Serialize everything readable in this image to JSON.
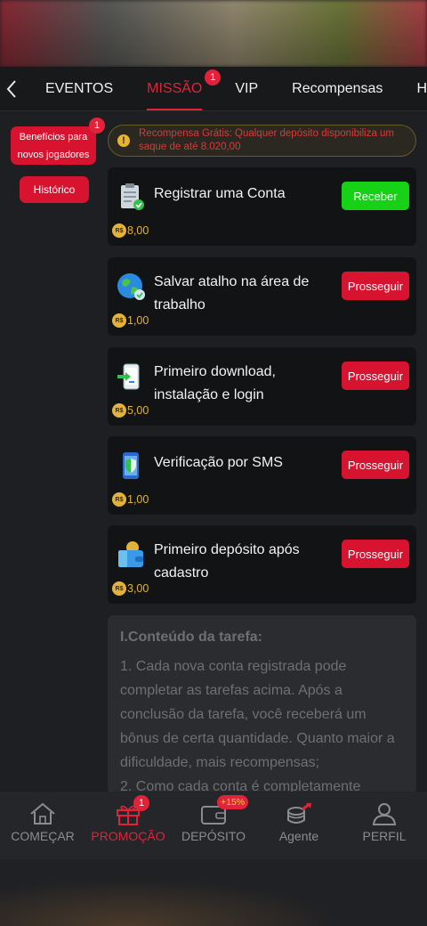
{
  "tabs": {
    "items": [
      "EVENTOS",
      "MISSÃO",
      "VIP",
      "Recompensas",
      "H"
    ],
    "active": "MISSÃO",
    "mission_badge": "1"
  },
  "left": {
    "new_players_label": "Benefícios para novos jogadores",
    "new_players_badge": "1",
    "history_label": "Histórico"
  },
  "notice": {
    "text": "Recompensa Grátis: Qualquer depósito disponibiliza um saque de até 8.020,00"
  },
  "currency_symbol": "R$",
  "tasks": [
    {
      "title": "Registrar uma Conta",
      "reward": "8,00",
      "action": "Receber",
      "icon": "clipboard-check-icon"
    },
    {
      "title": "Salvar atalho na área de trabalho",
      "reward": "1,00",
      "action": "Prosseguir",
      "icon": "globe-icon"
    },
    {
      "title": "Primeiro download, instalação e login",
      "reward": "5,00",
      "action": "Prosseguir",
      "icon": "phone-download-icon"
    },
    {
      "title": "Verificação por SMS",
      "reward": "1,00",
      "action": "Prosseguir",
      "icon": "phone-shield-icon"
    },
    {
      "title": "Primeiro depósito após cadastro",
      "reward": "3,00",
      "action": "Prosseguir",
      "icon": "wallet-coin-icon"
    }
  ],
  "content": {
    "heading": "I.Conteúdo da tarefa:",
    "p1": "1. Cada nova conta registrada pode completar as tarefas acima. Após a conclusão da tarefa, você receberá um bônus de certa quantidade. Quanto maior a dificuldade, mais recompensas;",
    "p2": "2. Como cada conta é completamente"
  },
  "nav": {
    "items": [
      "COMEÇAR",
      "PROMOÇÃO",
      "DEPÓSITO",
      "Agente",
      "PERFIL"
    ],
    "promo_badge": "1",
    "deposit_badge": "+15%",
    "active": "PROMOÇÃO"
  },
  "colors": {
    "accent": "#e0233a",
    "green_button": "#16d116",
    "coin": "#e3b23a"
  }
}
